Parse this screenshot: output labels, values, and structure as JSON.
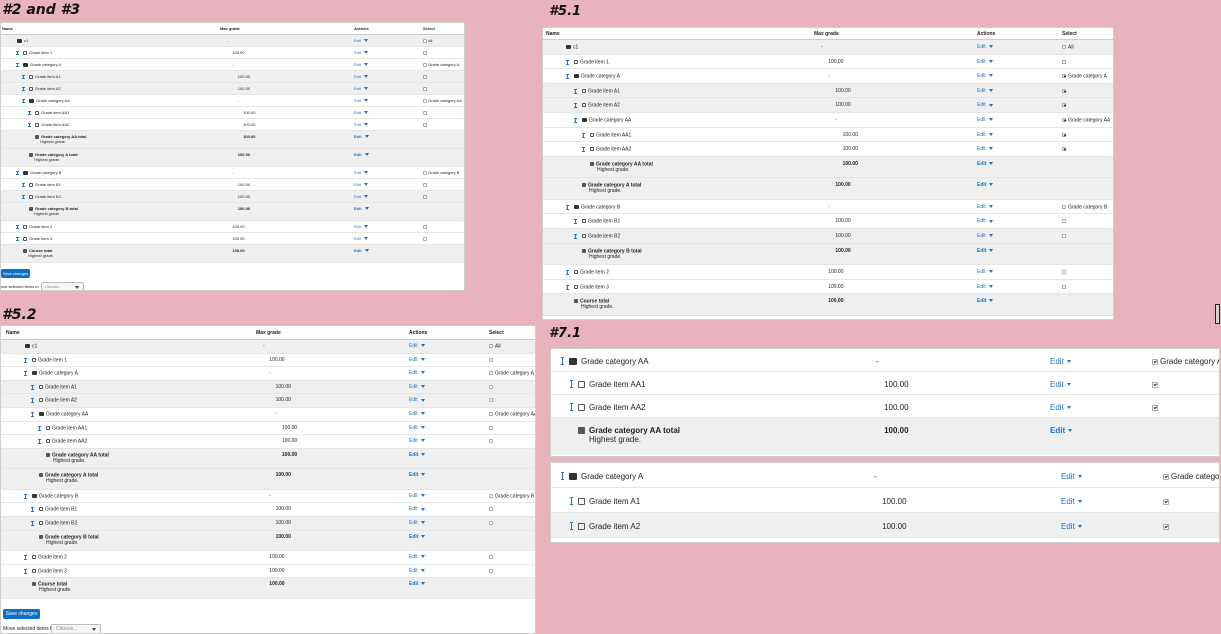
{
  "labels": {
    "p1": "#2 and #3",
    "p2": "#5.1",
    "p3": "#5.2",
    "p4": "#7.1"
  },
  "columns": {
    "name": "Name",
    "max_grade": "Max grade",
    "actions": "Actions",
    "select": "Select"
  },
  "common": {
    "edit_label": "Edit",
    "highest_grade": "Highest grade.",
    "all_label": "All",
    "save_changes": "Save changes",
    "move_label": "Move selected items to",
    "move_label_short": "ove selected items to",
    "choose_placeholder": "Choose..."
  },
  "colors": {
    "background": "#e8b2bf",
    "accent": "#0f6fc5",
    "link": "#1a73c9"
  },
  "grade_rows": [
    {
      "name": "c1",
      "max": "-",
      "icon": "folder-icon",
      "select": "All"
    },
    {
      "name": "Grade item 1",
      "max": "100.00",
      "icon": "item-icon"
    },
    {
      "name": "Grade category A",
      "max": "-",
      "icon": "folder-icon",
      "select": "Grade category A"
    },
    {
      "name": "Grade item A1",
      "max": "100.00",
      "icon": "item-icon"
    },
    {
      "name": "Grade item A2",
      "max": "100.00",
      "icon": "item-icon"
    },
    {
      "name": "Grade category AA",
      "max": "-",
      "icon": "folder-icon",
      "select": "Grade category AA"
    },
    {
      "name": "Grade item AA1",
      "max": "100.00",
      "icon": "item-icon"
    },
    {
      "name": "Grade item AA2",
      "max": "100.00",
      "icon": "item-icon"
    },
    {
      "name": "Grade category AA total",
      "max": "100.00",
      "icon": "calculator-icon",
      "sub": "Highest grade."
    },
    {
      "name": "Grade category A total",
      "max": "100.00",
      "icon": "calculator-icon",
      "sub": "Highest grade."
    },
    {
      "name": "Grade category B",
      "max": "-",
      "icon": "folder-icon",
      "select": "Grade category B"
    },
    {
      "name": "Grade item B1",
      "max": "100.00",
      "icon": "item-icon"
    },
    {
      "name": "Grade item B2",
      "max": "100.00",
      "icon": "item-icon"
    },
    {
      "name": "Grade category B total",
      "max": "100.00",
      "icon": "calculator-icon",
      "sub": "Highest grade."
    },
    {
      "name": "Grade item 2",
      "max": "100.00",
      "icon": "item-icon"
    },
    {
      "name": "Grade item 3",
      "max": "100.00",
      "icon": "item-icon"
    },
    {
      "name": "Course total",
      "max": "100.00",
      "icon": "calculator-icon",
      "sub": "Highest grade."
    }
  ],
  "zoom_panel_1_rows": [
    {
      "name": "Grade category AA",
      "max": "-",
      "icon": "folder-icon",
      "select": "Grade category AA"
    },
    {
      "name": "Grade item AA1",
      "max": "100.00",
      "icon": "item-icon"
    },
    {
      "name": "Grade item AA2",
      "max": "100.00",
      "icon": "item-icon"
    },
    {
      "name": "Grade category AA total",
      "max": "100.00",
      "icon": "calculator-icon",
      "sub": "Highest grade."
    }
  ],
  "zoom_panel_2_rows": [
    {
      "name": "Grade category A",
      "max": "-",
      "icon": "folder-icon",
      "select": "Grade category A"
    },
    {
      "name": "Grade item A1",
      "max": "100.00",
      "icon": "item-icon"
    },
    {
      "name": "Grade item A2",
      "max": "100.00",
      "icon": "item-icon"
    }
  ]
}
